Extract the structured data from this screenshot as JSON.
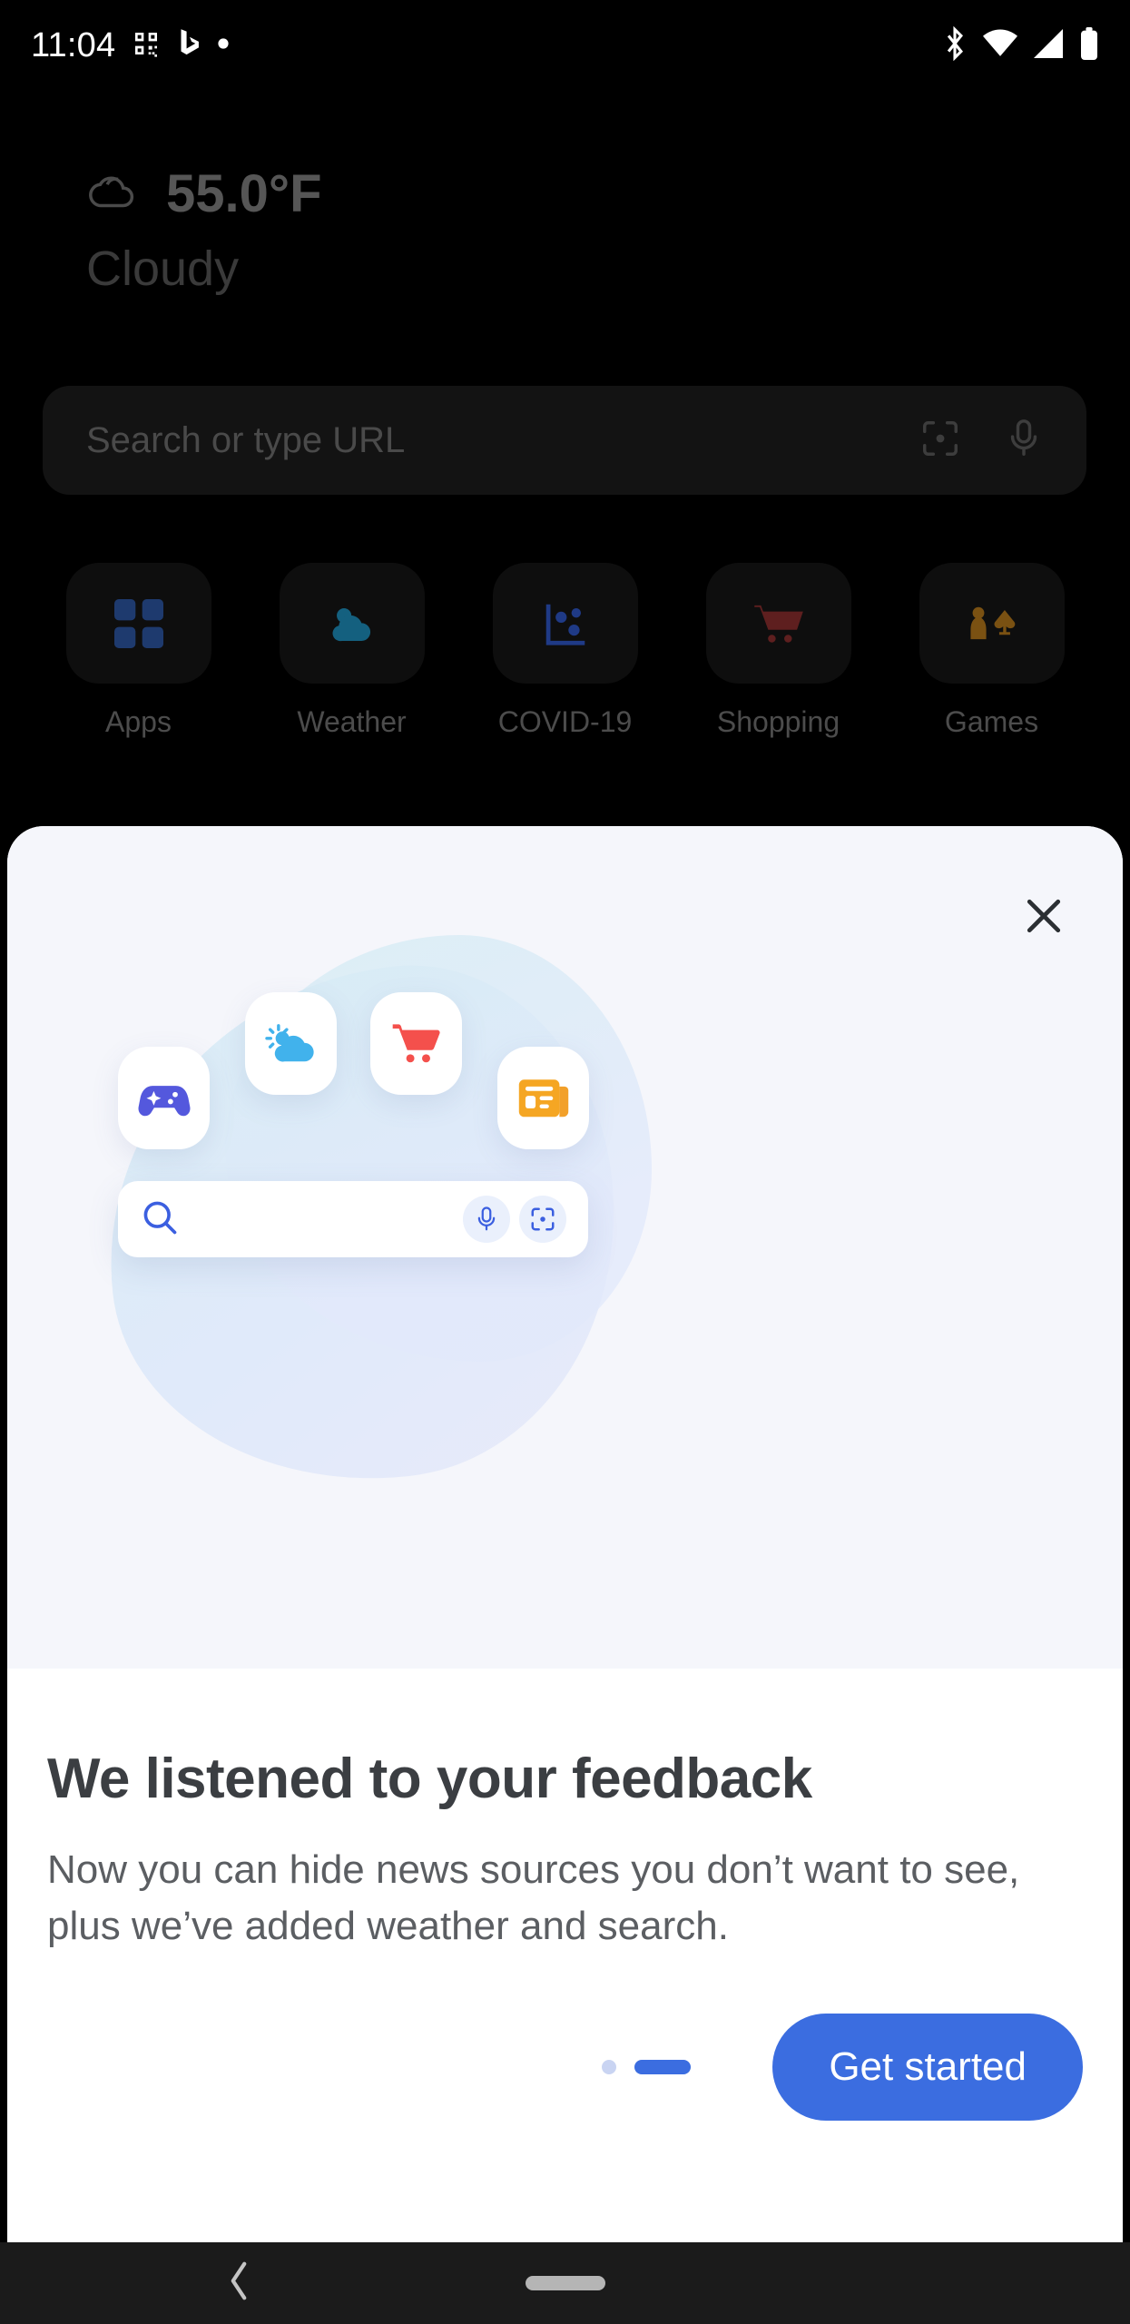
{
  "status_bar": {
    "time": "11:04",
    "left_icons": [
      "qr-code-icon",
      "bing-logo-icon",
      "dot-icon"
    ],
    "right_icons": [
      "bluetooth-icon",
      "wifi-icon",
      "cell-signal-icon",
      "battery-icon"
    ]
  },
  "background_home": {
    "weather": {
      "icon": "cloud-icon",
      "temperature": "55.0°F",
      "condition": "Cloudy"
    },
    "search": {
      "placeholder": "Search or type URL",
      "scan_icon": "qr-scan-icon",
      "voice_icon": "microphone-icon"
    },
    "shortcuts": [
      {
        "label": "Apps",
        "icon": "apps-grid-icon",
        "color": "#1e3a6e"
      },
      {
        "label": "Weather",
        "icon": "weather-cloud-sun-icon",
        "color": "#14607f"
      },
      {
        "label": "COVID-19",
        "icon": "covid-chart-icon",
        "color": "#1f3a86"
      },
      {
        "label": "Shopping",
        "icon": "shopping-cart-icon",
        "color": "#5e1f1f"
      },
      {
        "label": "Games",
        "icon": "games-pawn-spade-icon",
        "color": "#7a5112"
      }
    ]
  },
  "sheet": {
    "close_icon": "close-icon",
    "illustration": {
      "tiles": [
        {
          "name": "games-tile",
          "icon": "gamepad-icon",
          "color": "#5458dd"
        },
        {
          "name": "weather-tile",
          "icon": "weather-cloud-sun-icon",
          "color": "#41b2ec"
        },
        {
          "name": "shopping-tile",
          "icon": "shopping-cart-icon",
          "color": "#f4504c"
        },
        {
          "name": "news-tile",
          "icon": "news-article-icon",
          "color": "#f5a623"
        }
      ],
      "search": {
        "search_icon": "search-icon",
        "voice_icon": "microphone-icon",
        "scan_icon": "qr-scan-icon",
        "accent": "#3b5fe0"
      }
    },
    "title": "We listened to your feedback",
    "body": "Now you can hide news sources you don’t want to see, plus we’ve added weather and search.",
    "pagination": {
      "total": 2,
      "active_index": 1
    },
    "cta_label": "Get started",
    "cta_color": "#3b6de0"
  },
  "nav_bar": {
    "back_icon": "back-chevron-icon",
    "home_icon": "home-pill-icon"
  }
}
